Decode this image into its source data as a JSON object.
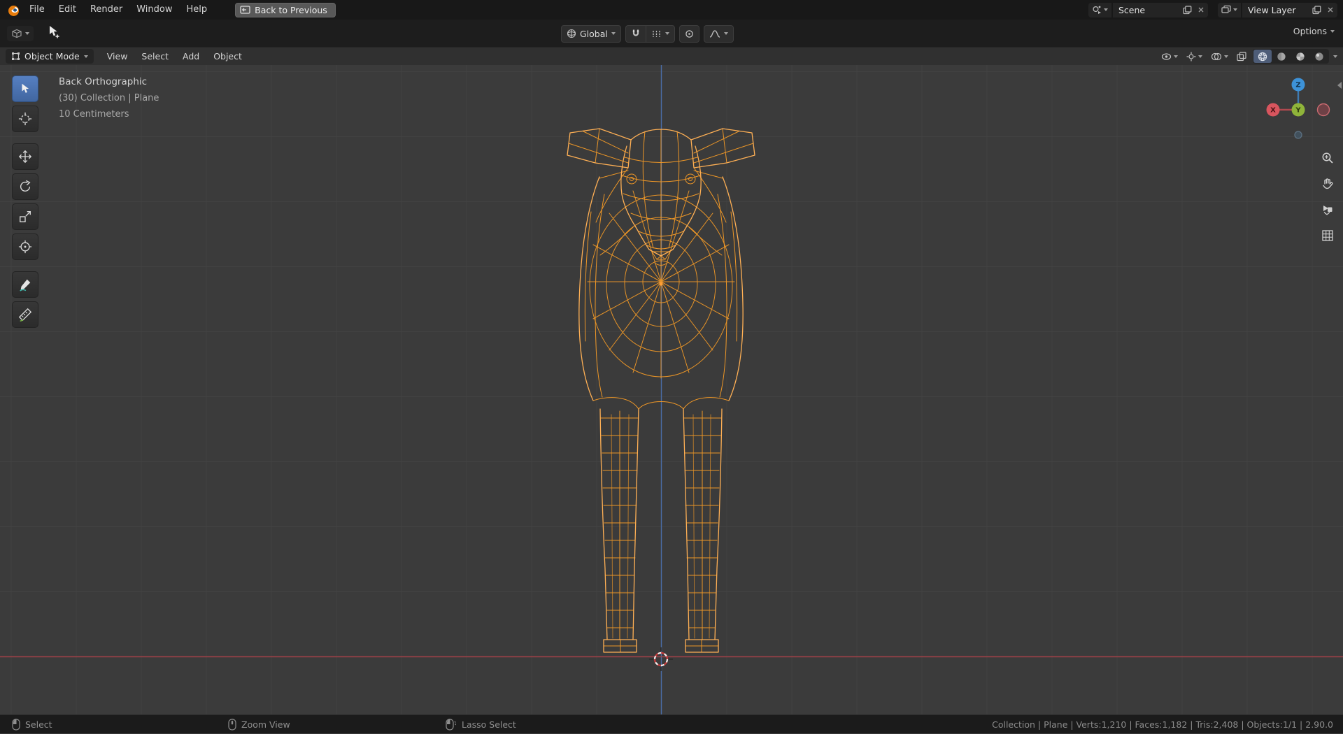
{
  "topbar": {
    "menus": [
      "File",
      "Edit",
      "Render",
      "Window",
      "Help"
    ],
    "back_button_label": "Back to Previous",
    "scene_name": "Scene",
    "view_layer_name": "View Layer"
  },
  "tool_settings": {
    "orientation_label": "Global",
    "options_label": "Options"
  },
  "viewport_header": {
    "mode_label": "Object Mode",
    "menus": [
      "View",
      "Select",
      "Add",
      "Object"
    ]
  },
  "viewport_overlay": {
    "view_name": "Back Orthographic",
    "active_object": "(30) Collection | Plane",
    "grid_scale": "10 Centimeters"
  },
  "axis_gizmo": {
    "x_label": "X",
    "y_label": "Y",
    "z_label": "Z"
  },
  "status_bar": {
    "hints": [
      {
        "icon": "mouse-left",
        "label": "Select"
      },
      {
        "icon": "mouse-middle",
        "label": "Zoom View"
      },
      {
        "icon": "mouse-left-drag",
        "label": "Lasso Select"
      }
    ],
    "stats": "Collection | Plane | Verts:1,210 | Faces:1,182 | Tris:2,408 | Objects:1/1 | 2.90.0"
  },
  "colors": {
    "wireframe_selected": "#f09b2a",
    "active_tool": "#4772b3",
    "axis_x": "#9e4147",
    "axis_z": "#4a6da8"
  }
}
